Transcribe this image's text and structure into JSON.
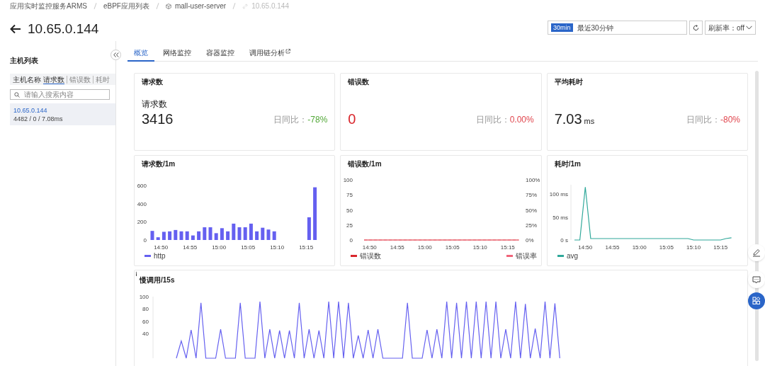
{
  "breadcrumb": [
    {
      "label": "应用实时监控服务ARMS",
      "kind": "plain",
      "current": false
    },
    {
      "label": "eBPF应用列表",
      "kind": "plain",
      "current": false
    },
    {
      "label": "mall-user-server",
      "kind": "app",
      "current": false
    },
    {
      "label": "10.65.0.144",
      "kind": "instance",
      "current": true
    }
  ],
  "page_title": "10.65.0.144",
  "time_range": {
    "badge": "30min",
    "label": "最近30分钟"
  },
  "refresh_rate": "刷新率：off",
  "sidebar": {
    "title": "主机列表",
    "column_label": "主机名称",
    "sort_options": [
      {
        "label": "请求数",
        "selected": true
      },
      {
        "label": "错误数",
        "selected": false
      },
      {
        "label": "耗时",
        "selected": false
      }
    ],
    "search": {
      "placeholder": "请输入搜索内容"
    },
    "hosts": [
      {
        "name": "10.65.0.144",
        "stats": "4482 / 0 / 7.08ms",
        "selected": true
      }
    ]
  },
  "tabs": [
    {
      "label": "概览",
      "selected": true,
      "external": false
    },
    {
      "label": "网络监控",
      "selected": false,
      "external": false
    },
    {
      "label": "容器监控",
      "selected": false,
      "external": false
    },
    {
      "label": "调用链分析",
      "selected": false,
      "external": true
    }
  ],
  "stat_cards": [
    {
      "title": "请求数",
      "label": "请求数",
      "value": "3416",
      "alert": false,
      "change_label": "日同比：",
      "change_value": "-78%",
      "color": "#52a838"
    },
    {
      "title": "错误数",
      "value": "0",
      "alert": true,
      "change_label": "日同比：",
      "change_value": "0.00%",
      "color": "#e0464e"
    },
    {
      "title": "平均耗时",
      "value": "7.03",
      "unit": "ms",
      "alert": false,
      "change_label": "日同比：",
      "change_value": "-80%",
      "color": "#e0464e"
    }
  ],
  "charts": [
    {
      "title": "请求数/1m",
      "chart_data": {
        "type": "bar",
        "legend": "bottom",
        "categories": [
          null,
          "14:50",
          null,
          null,
          null,
          null,
          "14:55",
          null,
          null,
          null,
          null,
          "15:00",
          null,
          null,
          null,
          null,
          "15:05",
          null,
          null,
          null,
          null,
          "15:10",
          null,
          null,
          null,
          null,
          "15:15",
          null,
          null
        ],
        "series": [
          {
            "name": "http",
            "color": "#6560f0",
            "values": [
              100,
              30,
              90,
              95,
              110,
              95,
              95,
              50,
              95,
              140,
              140,
              75,
              130,
              95,
              180,
              140,
              140,
              180,
              95,
              135,
              115,
              95,
              null,
              null,
              null,
              null,
              null,
              250,
              580
            ]
          }
        ],
        "ylim": [
          0,
          600
        ],
        "yticks": [
          0,
          200,
          400,
          600
        ]
      }
    },
    {
      "title": "错误数/1m",
      "chart_data": {
        "type": "line",
        "legend": "bottom",
        "categories": [
          null,
          "14:50",
          null,
          null,
          null,
          null,
          "14:55",
          null,
          null,
          null,
          null,
          "15:00",
          null,
          null,
          null,
          null,
          "15:05",
          null,
          null,
          null,
          null,
          "15:10",
          null,
          null,
          null,
          null,
          "15:15",
          null,
          null
        ],
        "series": [
          {
            "name": "错误数",
            "color": "#d9262c",
            "line_style": "solid",
            "values": [
              0,
              0,
              0,
              0,
              0,
              0,
              0,
              0,
              0,
              0,
              0,
              0,
              0,
              0,
              0,
              0,
              0,
              0,
              0,
              0,
              0,
              0,
              0,
              0,
              0,
              0,
              0,
              0,
              0
            ]
          },
          {
            "name": "错误率",
            "color": "#f0657a",
            "line_style": "dashed",
            "values": [
              0,
              0,
              0,
              0,
              0,
              0,
              0,
              0,
              0,
              0,
              0,
              0,
              0,
              0,
              0,
              0,
              0,
              0,
              0,
              0,
              0,
              0,
              0,
              0,
              0,
              0,
              0,
              0,
              0
            ]
          }
        ],
        "ylim": [
          0,
          100
        ],
        "yticks": [
          0,
          25,
          50,
          75,
          100
        ],
        "y2lim": [
          0,
          100
        ],
        "y2ticks": [
          {
            "value": 0,
            "label": "0%"
          },
          {
            "value": 25,
            "label": "25%"
          },
          {
            "value": 50,
            "label": "50%"
          },
          {
            "value": 75,
            "label": "75%"
          },
          {
            "value": 100,
            "label": "100%"
          }
        ]
      }
    },
    {
      "title": "耗时/1m",
      "chart_data": {
        "type": "line",
        "legend": "bottom",
        "categories": [
          null,
          null,
          "14:50",
          null,
          null,
          null,
          null,
          "14:55",
          null,
          null,
          null,
          null,
          "15:00",
          null,
          null,
          null,
          null,
          "15:05",
          null,
          null,
          null,
          null,
          "15:10",
          null,
          null,
          null,
          null,
          "15:15",
          null,
          null
        ],
        "series": [
          {
            "name": "avg",
            "color": "#2fa89a",
            "line_style": "solid",
            "values": [
              0,
              0,
              115,
              3,
              3,
              3,
              3,
              3,
              3,
              3,
              3,
              3,
              3,
              3,
              3,
              3,
              3,
              3,
              3,
              3,
              3,
              3,
              0,
              0,
              0,
              0,
              0,
              0,
              3,
              5
            ]
          }
        ],
        "ylim": [
          0,
          120
        ],
        "yticks": [
          {
            "value": 0,
            "label": "0 s"
          },
          {
            "value": 50,
            "label": "50 ms"
          },
          {
            "value": 100,
            "label": "100 ms"
          }
        ]
      }
    }
  ],
  "slow_calls": {
    "title": "慢调用/15s",
    "chart_data": {
      "type": "line",
      "categories": [
        null,
        null,
        null,
        null,
        null,
        null,
        null,
        null,
        null,
        null,
        null,
        null,
        null,
        null,
        null,
        null,
        null,
        null,
        null,
        null,
        null,
        null,
        null,
        null,
        null,
        null,
        null,
        null,
        null,
        null,
        null,
        null,
        null,
        null,
        null,
        null,
        null,
        null,
        null,
        null,
        null,
        null,
        null,
        null,
        null,
        null,
        null,
        null,
        null,
        null,
        null,
        null,
        null,
        null,
        null,
        null,
        null,
        null,
        null,
        null,
        null,
        null,
        null,
        null,
        null,
        null,
        null,
        null,
        null,
        null,
        null,
        null,
        null,
        null,
        null,
        null,
        null,
        null,
        null
      ],
      "series": [
        {
          "color": "#6560f0",
          "line_style": "solid",
          "values": [
            0,
            28,
            0,
            46,
            0,
            90,
            0,
            0,
            0,
            47,
            0,
            0,
            0,
            90,
            0,
            0,
            0,
            92,
            0,
            47,
            0,
            45,
            0,
            45,
            0,
            90,
            0,
            47,
            0,
            45,
            0,
            92,
            0,
            92,
            0,
            90,
            0,
            37,
            0,
            46,
            0,
            47,
            0,
            0,
            0,
            0,
            0,
            90,
            0,
            0,
            0,
            46,
            0,
            47,
            0,
            92,
            0,
            90,
            0,
            92,
            0,
            92,
            0,
            92,
            0,
            92,
            0,
            47,
            0,
            92,
            0,
            88,
            0,
            48,
            0,
            92,
            0,
            89,
            0
          ]
        }
      ],
      "ylim": [
        0,
        100
      ],
      "yticks": [
        40,
        60,
        80,
        100
      ]
    }
  }
}
